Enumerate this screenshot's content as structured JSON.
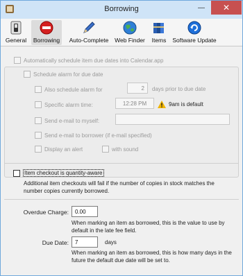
{
  "window": {
    "title": "Borrowing",
    "close_glyph": "✕",
    "minimize_glyph": "—"
  },
  "toolbar": {
    "items": [
      {
        "label": "General",
        "icon": "switch-icon"
      },
      {
        "label": "Borrowing",
        "icon": "no-entry-icon"
      },
      {
        "label": "Auto-Complete",
        "icon": "pen-icon"
      },
      {
        "label": "Web Finder",
        "icon": "globe-icon"
      },
      {
        "label": "Items",
        "icon": "books-icon"
      },
      {
        "label": "Software Update",
        "icon": "refresh-icon"
      }
    ],
    "selected": "Borrowing"
  },
  "schedule": {
    "auto_schedule_label": "Automatically schedule item due dates into Calendar.app",
    "alarm_label": "Schedule alarm for due date",
    "also_schedule_label": "Also schedule alarm for",
    "days_value": "2",
    "days_suffix": "days prior to due date",
    "specific_time_label": "Specific alarm time:",
    "time_value": "12:28 PM",
    "time_default_note": "9am is default",
    "send_email_myself_label": "Send e-mail to myself:",
    "email_value": "",
    "send_email_borrower_label": "Send e-mail to borrower (if e-mail specified)",
    "display_alert_label": "Display an alert",
    "with_sound_label": "with sound"
  },
  "quantity": {
    "label": "Item checkout is quantity-aware",
    "note": "Additional item checkouts will fail if the number of copies in stock matches the number copies currently borrowed."
  },
  "overdue": {
    "label": "Overdue Charge:",
    "value": "0.00",
    "note": "When marking an item as borrowed, this is the value to use by default in the late fee field."
  },
  "due_date": {
    "label": "Due Date:",
    "value": "7",
    "suffix": "days",
    "note": "When marking an item as borrowed, this is how many days in the future the default due date will be set to."
  },
  "colors": {
    "accent": "#6fa8dc",
    "close": "#c75050",
    "warning": "#f0b400"
  }
}
